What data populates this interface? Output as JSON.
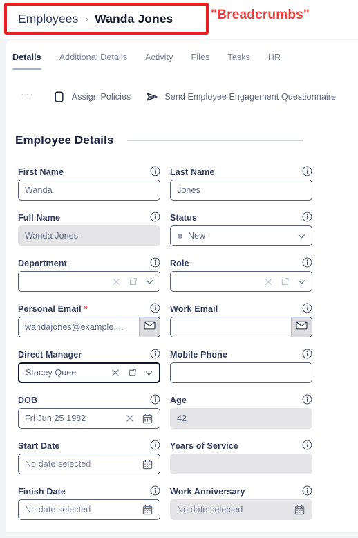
{
  "annotation": {
    "text": "\"Breadcrumbs\"",
    "color": "#f23c3c",
    "highlight_box_color": "#ee1c1c"
  },
  "breadcrumb": {
    "root": "Employees",
    "separator": "›",
    "leaf": "Wanda Jones"
  },
  "tabs": [
    {
      "label": "Details",
      "active": true
    },
    {
      "label": "Additional Details",
      "active": false
    },
    {
      "label": "Activity",
      "active": false
    },
    {
      "label": "Files",
      "active": false
    },
    {
      "label": "Tasks",
      "active": false
    },
    {
      "label": "HR",
      "active": false
    }
  ],
  "toolbar": {
    "overflow_label": "···",
    "actions": [
      {
        "label": "Assign Policies",
        "icon": "document-icon"
      },
      {
        "label": "Send Employee Engagement Questionnaire",
        "icon": "send-paper-plane-icon"
      }
    ]
  },
  "section": {
    "title": "Employee Details"
  },
  "form": {
    "rows": [
      {
        "left": {
          "label": "First Name",
          "required": false,
          "value": "Wanda",
          "state": "editable",
          "controls": []
        },
        "right": {
          "label": "Last Name",
          "required": false,
          "value": "Jones",
          "state": "editable",
          "controls": []
        }
      },
      {
        "left": {
          "label": "Full Name",
          "required": false,
          "value": "Wanda Jones",
          "state": "readonly",
          "controls": []
        },
        "right": {
          "label": "Status",
          "required": false,
          "value": "New",
          "state": "editable",
          "dot": true,
          "controls": [
            "chevron-down"
          ]
        }
      },
      {
        "left": {
          "label": "Department",
          "required": false,
          "value": "",
          "state": "editable",
          "controls": [
            "clear",
            "open-external",
            "chevron-down"
          ]
        },
        "right": {
          "label": "Role",
          "required": false,
          "value": "",
          "state": "editable",
          "controls": [
            "clear",
            "open-external",
            "chevron-down"
          ]
        }
      },
      {
        "left": {
          "label": "Personal Email",
          "required": true,
          "value": "wandajones@example....",
          "state": "editable",
          "controls": [
            "envelope-button"
          ]
        },
        "right": {
          "label": "Work Email",
          "required": false,
          "value": "",
          "state": "editable",
          "controls": [
            "envelope-button"
          ]
        }
      },
      {
        "left": {
          "label": "Direct Manager",
          "required": false,
          "value": "Stacey Quee",
          "state": "focused",
          "controls": [
            "clear",
            "open-external",
            "chevron-down"
          ]
        },
        "right": {
          "label": "Mobile Phone",
          "required": false,
          "value": "",
          "state": "editable",
          "controls": []
        }
      },
      {
        "left": {
          "label": "DOB",
          "required": false,
          "value": "Fri Jun 25 1982",
          "state": "editable",
          "controls": [
            "clear",
            "calendar"
          ]
        },
        "right": {
          "label": "Age",
          "required": false,
          "value": "42",
          "state": "readonly",
          "controls": []
        }
      },
      {
        "left": {
          "label": "Start Date",
          "required": false,
          "value": "No date selected",
          "state": "editable",
          "controls": [
            "calendar"
          ]
        },
        "right": {
          "label": "Years of Service",
          "required": false,
          "value": "",
          "state": "readonly",
          "controls": []
        }
      },
      {
        "left": {
          "label": "Finish Date",
          "required": false,
          "value": "No date selected",
          "state": "editable",
          "controls": [
            "calendar"
          ]
        },
        "right": {
          "label": "Work Anniversary",
          "required": false,
          "value": "No date selected",
          "state": "readonly",
          "controls": [
            "calendar"
          ]
        }
      }
    ]
  }
}
